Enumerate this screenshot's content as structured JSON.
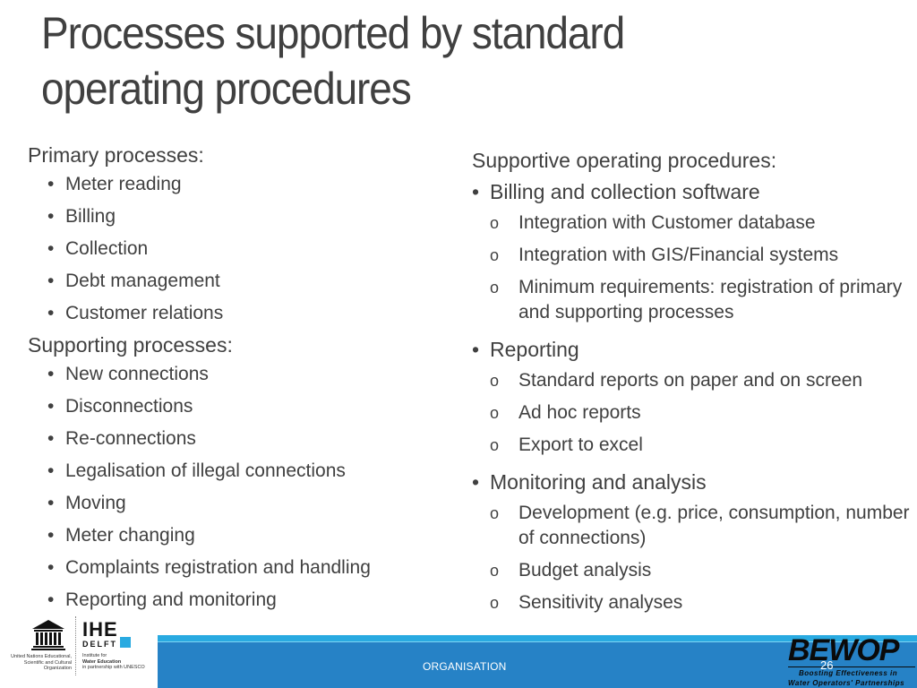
{
  "slide": {
    "title": "Processes supported by standard operating procedures",
    "left_column": {
      "primary": {
        "heading": "Primary processes:",
        "items": [
          "Meter reading",
          "Billing",
          "Collection",
          "Debt management",
          "Customer relations"
        ]
      },
      "supporting": {
        "heading": "Supporting processes:",
        "items": [
          "New connections",
          "Disconnections",
          "Re-connections",
          "Legalisation of illegal connections",
          "Moving",
          "Meter changing",
          "Complaints registration and handling",
          "Reporting and monitoring"
        ]
      }
    },
    "right_column": {
      "heading": "Supportive operating procedures:",
      "groups": [
        {
          "label": "Billing and collection software",
          "items": [
            "Integration with Customer database",
            "Integration with GIS/Financial systems",
            "Minimum requirements: registration of primary and supporting processes"
          ]
        },
        {
          "label": "Reporting",
          "items": [
            "Standard reports on paper and on screen",
            "Ad hoc reports",
            "Export to excel"
          ]
        },
        {
          "label": "Monitoring and analysis",
          "items": [
            "Development (e.g. price, consumption, number of connections)",
            "Budget analysis",
            "Sensitivity analyses"
          ]
        }
      ]
    },
    "bullet_glyph": "•",
    "sub_bullet_glyph": "o"
  },
  "footer": {
    "label": "ORGANISATION",
    "page_number": "26",
    "colors": {
      "band_top": "#29aae1",
      "band": "#2682c6"
    }
  },
  "logos": {
    "unesco": {
      "acronym": "UNESCO",
      "caption": "United Nations Educational, Scientific and Cultural Organization"
    },
    "ihe": {
      "name": "IHE",
      "sub": "DELFT",
      "caption_line1": "Institute for",
      "caption_line2": "Water Education",
      "caption_line3": "in partnership with UNESCO"
    },
    "bewop": {
      "name": "BEWOP",
      "tagline1": "Boosting Effectiveness in",
      "tagline2": "Water Operators' Partnerships"
    }
  }
}
